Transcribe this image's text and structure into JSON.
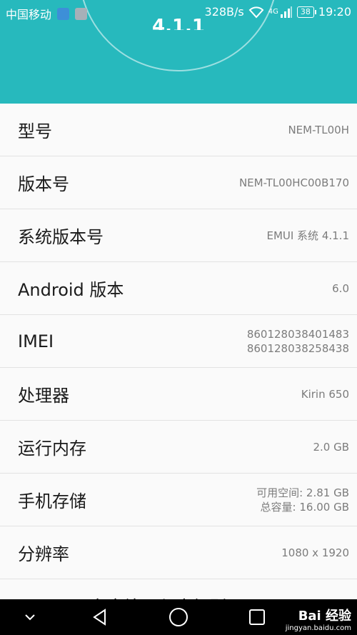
{
  "status_bar": {
    "carrier": "中国移动",
    "speed": "328B/s",
    "network": "4G",
    "battery": "38",
    "time": "19:20"
  },
  "header": {
    "version_text": "4.1.1",
    "background_color": "#27b9bd"
  },
  "rows": [
    {
      "label": "型号",
      "value": "NEM-TL00H"
    },
    {
      "label": "版本号",
      "value": "NEM-TL00HC00B170"
    },
    {
      "label": "系统版本号",
      "value": "EMUI 系统 4.1.1"
    },
    {
      "label": "Android 版本",
      "value": "6.0"
    },
    {
      "label": "IMEI",
      "value": "860128038401483",
      "value2": "860128038258438"
    },
    {
      "label": "处理器",
      "value": "Kirin 650"
    },
    {
      "label": "运行内存",
      "value": "2.0 GB"
    },
    {
      "label": "手机存储",
      "value": "可用空间:  2.81  GB",
      "value2": "总容量:  16.00  GB"
    },
    {
      "label": "分辨率",
      "value": "1080 x 1920"
    },
    {
      "label": "Android 安全补丁程序级别",
      "value": ""
    }
  ],
  "watermark": {
    "brand": "Bai 经验",
    "url": "jingyan.baidu.com"
  }
}
